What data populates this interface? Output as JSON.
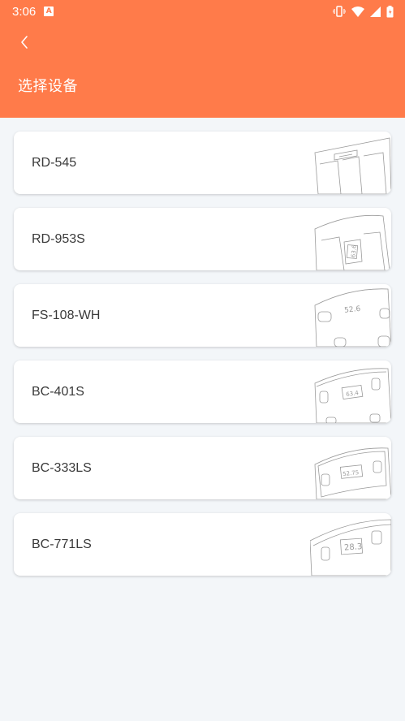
{
  "status_bar": {
    "time": "3:06",
    "notification_icon": "a-letter-icon",
    "right_icons": [
      "vibrate-icon",
      "wifi-icon",
      "signal-icon",
      "battery-icon"
    ]
  },
  "header": {
    "title": "选择设备",
    "background_color": "#ff7b4a",
    "back_icon": "chevron-left-icon"
  },
  "devices": [
    {
      "label": "RD-545",
      "illustration": "rd-545-scale-icon"
    },
    {
      "label": "RD-953S",
      "illustration": "rd-953s-scale-icon"
    },
    {
      "label": "FS-108-WH",
      "illustration": "fs-108-wh-scale-icon"
    },
    {
      "label": "BC-401S",
      "illustration": "bc-401s-scale-icon"
    },
    {
      "label": "BC-333LS",
      "illustration": "bc-333ls-scale-icon"
    },
    {
      "label": "BC-771LS",
      "illustration": "bc-771ls-scale-icon"
    }
  ],
  "illustration_readouts": {
    "rd_953s": "63.6",
    "fs_108_wh": "52.6",
    "bc_401s": "63.4",
    "bc_333ls": "52.75",
    "bc_771ls": "28.3"
  }
}
